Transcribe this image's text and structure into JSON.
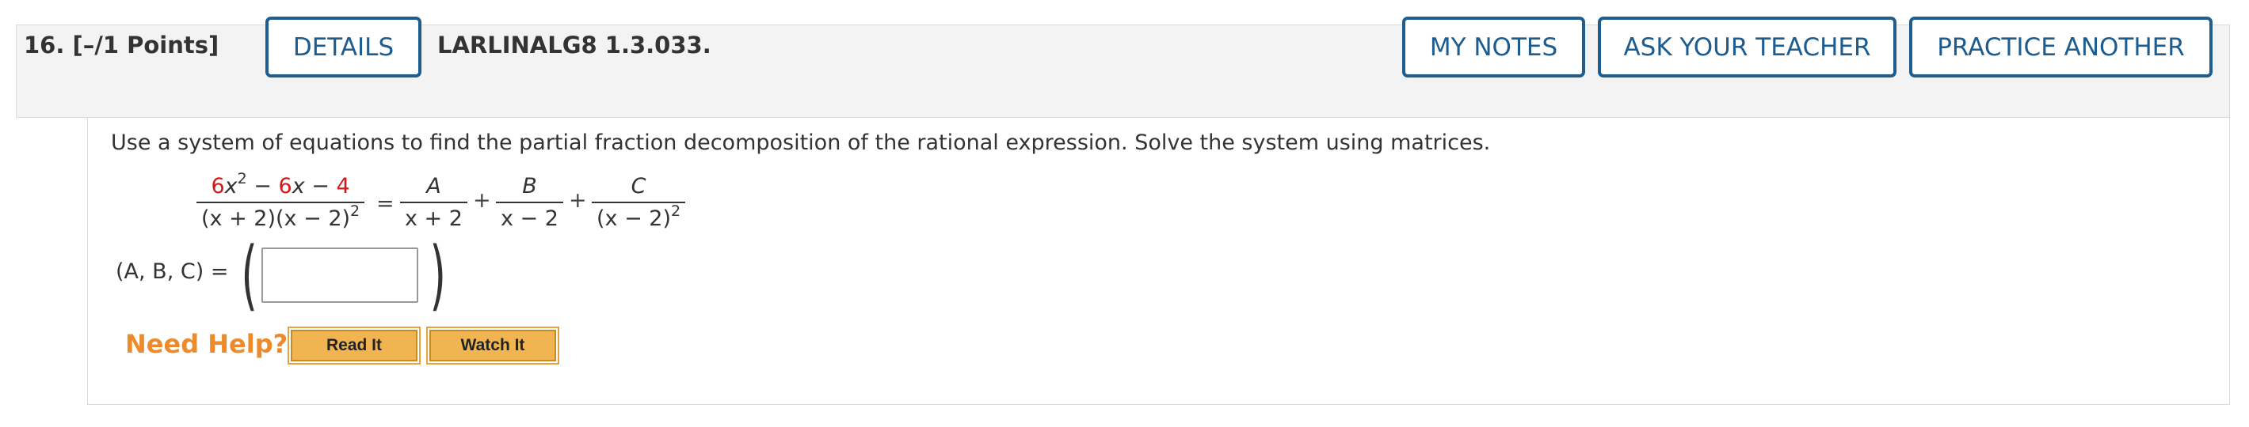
{
  "question": {
    "number": "16.",
    "points": "[–/1 Points]",
    "details_label": "DETAILS",
    "reference": "LARLINALG8 1.3.033."
  },
  "header_buttons": {
    "my_notes": "MY NOTES",
    "ask_teacher": "ASK YOUR TEACHER",
    "practice_another": "PRACTICE ANOTHER"
  },
  "prompt": "Use a system of equations to find the partial fraction decomposition of the rational expression. Solve the system using matrices.",
  "equation": {
    "lhs_num_coef1": "6",
    "lhs_num_var1": "x",
    "lhs_num_exp1": "2",
    "lhs_num_minus1": " − ",
    "lhs_num_coef2": "6",
    "lhs_num_var2": "x",
    "lhs_num_minus2": " − ",
    "lhs_num_const": "4",
    "lhs_den": "(x + 2)(x − 2)",
    "lhs_den_exp": "2",
    "equals": "=",
    "term1_num": "A",
    "term1_den": "x + 2",
    "plus1": "+",
    "term2_num": "B",
    "term2_den": "x − 2",
    "plus2": "+",
    "term3_num": "C",
    "term3_den": "(x − 2)",
    "term3_den_exp": "2"
  },
  "answer": {
    "label": "(A, B, C) =",
    "open_paren": "(",
    "close_paren": ")",
    "value": ""
  },
  "help": {
    "label": "Need Help?",
    "read_it": "Read It",
    "watch_it": "Watch It"
  },
  "colors": {
    "accent_blue": "#1f5d8f",
    "highlight_red": "#d0191a",
    "help_orange": "#ee8a2a",
    "help_button": "#f0b550"
  }
}
